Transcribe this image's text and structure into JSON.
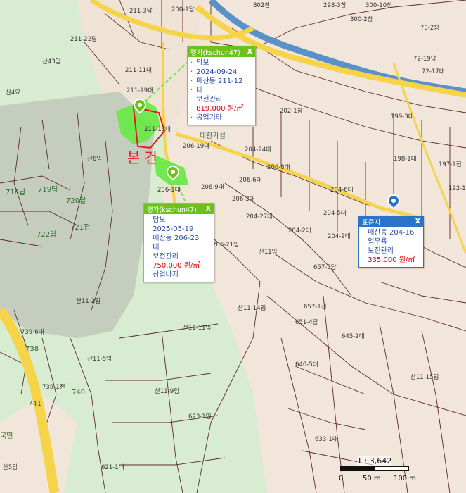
{
  "map": {
    "colors": {
      "forest": "#d7ecd0",
      "urban": "#f2e6da",
      "road_main": "#f5d44a",
      "river": "#5a92c8",
      "subject_fill": "#6be84a",
      "subject_outline": "#e41b1b",
      "green_accent": "#6cc11c",
      "blue_accent": "#2a73c9",
      "price_color": "#e00000"
    },
    "subject_label": "본건",
    "callout_1": {
      "title": "평가(kschun47)",
      "close": "X",
      "items": [
        "담보",
        "2024-09-24",
        "매산동 211-12",
        "대",
        "보전관리",
        "819,000 원/㎡",
        "공업기타"
      ]
    },
    "callout_2": {
      "title": "평가(kschun47)",
      "close": "X",
      "items": [
        "담보",
        "2025-05-19",
        "매산동 206-23",
        "대",
        "보전관리",
        "750,000 원/㎡",
        "상업나지"
      ]
    },
    "callout_3": {
      "title": "표준지",
      "close": "X",
      "items": [
        "매산동 204-16",
        "업무용",
        "보전관리",
        "335,000 원/㎡"
      ]
    },
    "scale": {
      "ratio": "1 : 3,642",
      "ticks": [
        "0",
        "50 m",
        "100 m"
      ]
    },
    "parcel_labels": [
      "200-1답",
      "211-3답",
      "211-22답",
      "211-11대",
      "211-19대",
      "산43임",
      "산4묘",
      "산6임",
      "211-13대",
      "206-1대",
      "206-9대",
      "206-6대",
      "206-8대",
      "206-3대",
      "206-21임",
      "206-19대",
      "204-27대",
      "204-24대",
      "204-6대",
      "204-9대",
      "204-5대",
      "204-2대",
      "202-1창",
      "199-3대",
      "198-1대",
      "197-1전",
      "192-1답",
      "802천",
      "300-10창",
      "300-2창",
      "298-3창",
      "70-2창",
      "72-19답",
      "72-17대",
      "719답",
      "720답",
      "722답",
      "721전",
      "718답",
      "산11임",
      "산11-2임",
      "산11-14임",
      "산11-11임",
      "산11-9임",
      "산11-5임",
      "산11-15임",
      "657-5답",
      "657-1전",
      "651-4답",
      "645-2대",
      "640-5대",
      "633-1대",
      "623-1임",
      "621-1대",
      "739-6대",
      "739-1전",
      "740",
      "741",
      "738",
      "산5임"
    ],
    "place_labels": [
      "대한가설",
      "국민"
    ]
  }
}
